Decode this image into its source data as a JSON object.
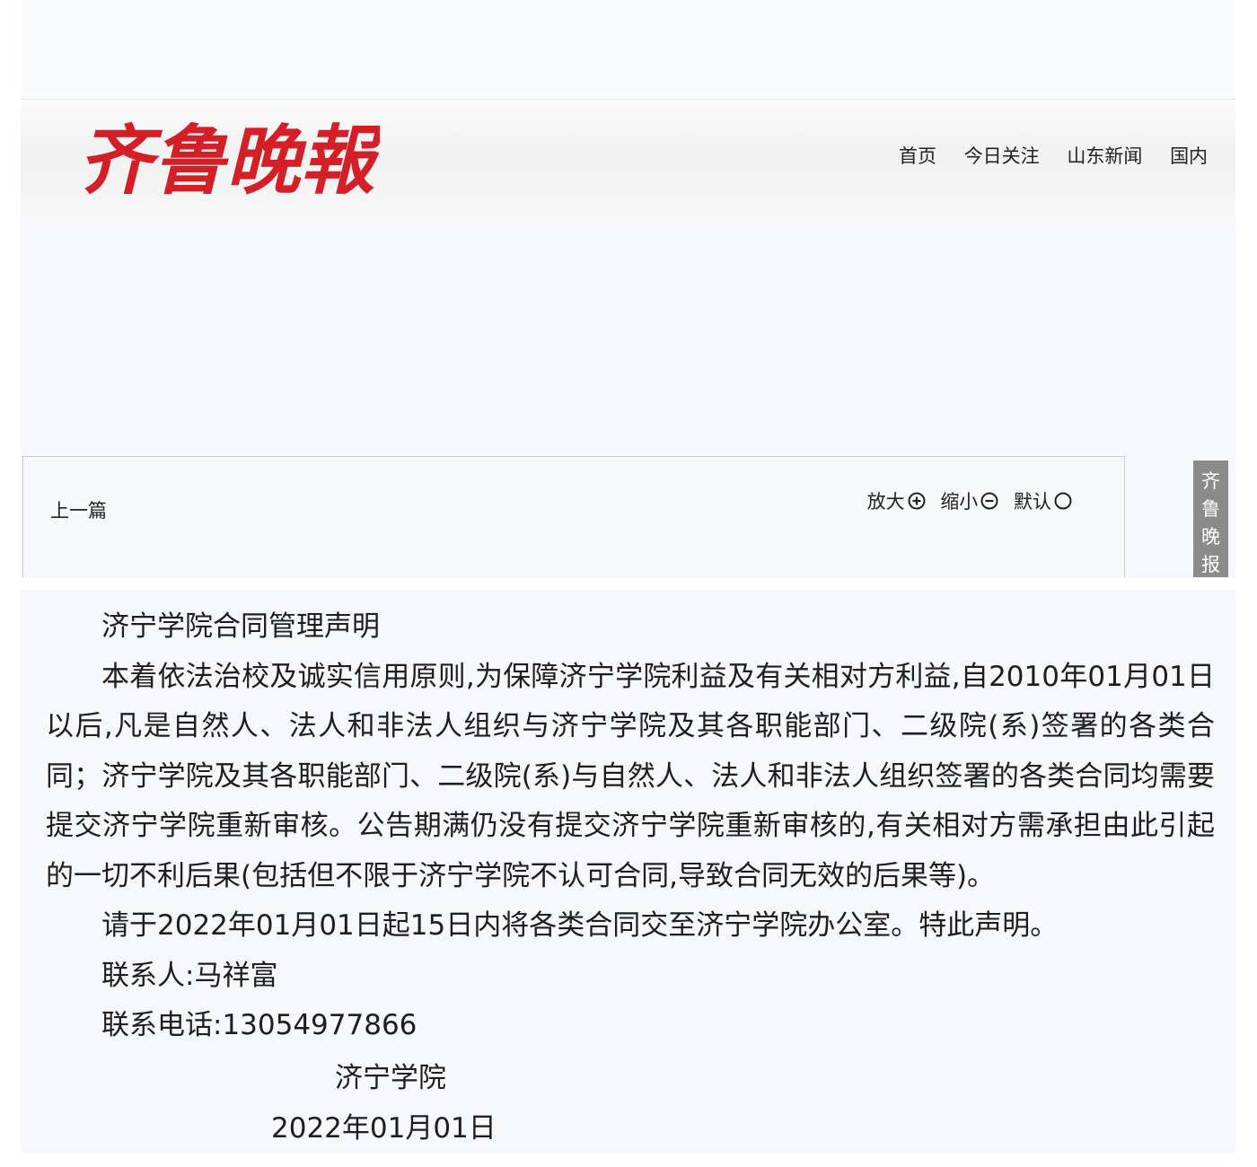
{
  "header": {
    "logo_text": "齐鲁晚報",
    "nav": [
      "首页",
      "今日关注",
      "山东新闻",
      "国内"
    ],
    "logo_color": "#d41f26"
  },
  "toolbar": {
    "prev_label": "上一篇",
    "zoom_in_label": "放大",
    "zoom_out_label": "缩小",
    "default_label": "默认"
  },
  "side_tab": {
    "chars": [
      "齐",
      "鲁",
      "晚",
      "报"
    ]
  },
  "article": {
    "title": "济宁学院合同管理声明",
    "paragraph_1": "本着依法治校及诚实信用原则,为保障济宁学院利益及有关相对方利益,自2010年01月01日以后,凡是自然人、法人和非法人组织与济宁学院及其各职能部门、二级院(系)签署的各类合同；济宁学院及其各职能部门、二级院(系)与自然人、法人和非法人组织签署的各类合同均需要提交济宁学院重新审核。公告期满仍没有提交济宁学院重新审核的,有关相对方需承担由此引起的一切不利后果(包括但不限于济宁学院不认可合同,导致合同无效的后果等)。",
    "paragraph_2": "请于2022年01月01日起15日内将各类合同交至济宁学院办公室。特此声明。",
    "contact_person": "联系人:马祥富",
    "contact_phone": "联系电话:13054977866",
    "signature_org": "济宁学院",
    "signature_date": "2022年01月01日"
  }
}
